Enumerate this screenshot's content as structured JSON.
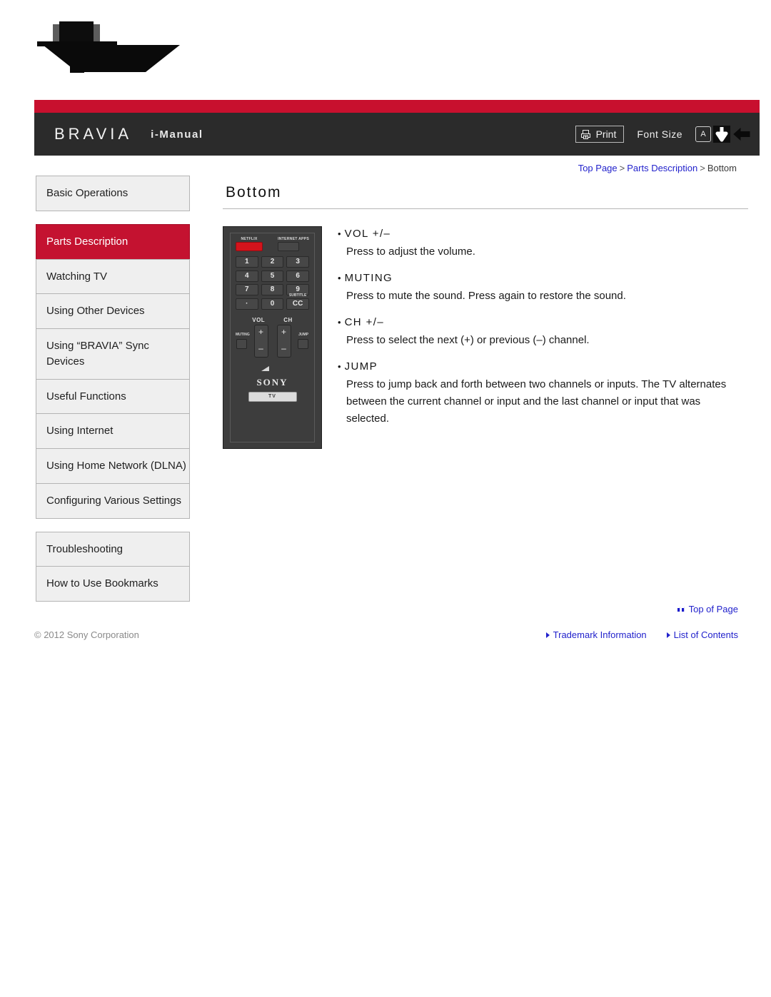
{
  "header": {
    "brand": "BRAVIA",
    "brand_sub": "i-Manual",
    "print_label": "Print",
    "font_size_label": "Font Size",
    "font_size_value": "A",
    "accent_red": "#c8102e",
    "bar_dark": "#2b2b2b"
  },
  "breadcrumb": {
    "items": [
      {
        "label": "Top Page",
        "link": true
      },
      {
        "label": "Parts Description",
        "link": true
      },
      {
        "label": "Bottom",
        "link": false
      }
    ],
    "separator": ">"
  },
  "sidebar": {
    "groups": [
      {
        "items": [
          {
            "label": "Basic Operations",
            "active": false
          }
        ]
      },
      {
        "items": [
          {
            "label": "Parts Description",
            "active": true
          },
          {
            "label": "Watching TV",
            "active": false
          },
          {
            "label": "Using Other Devices",
            "active": false
          },
          {
            "label": "Using “BRAVIA” Sync Devices",
            "active": false
          },
          {
            "label": "Useful Functions",
            "active": false
          },
          {
            "label": "Using Internet",
            "active": false
          },
          {
            "label": "Using Home Network (DLNA)",
            "active": false
          },
          {
            "label": "Configuring Various Settings",
            "active": false
          }
        ]
      },
      {
        "items": [
          {
            "label": "Troubleshooting",
            "active": false
          },
          {
            "label": "How to Use Bookmarks",
            "active": false
          }
        ]
      }
    ],
    "active_color": "#c41230"
  },
  "main": {
    "title": "Bottom",
    "remote": {
      "netflix_label": "NETFLIX",
      "internet_apps_label": "INTERNET APPS",
      "keys": [
        "1",
        "2",
        "3",
        "4",
        "5",
        "6",
        "7",
        "8",
        "9",
        "·",
        "0",
        "CC"
      ],
      "subtitle_label": "SUBTITLE",
      "vol_label": "VOL",
      "ch_label": "CH",
      "muting_label": "MUTING",
      "jump_label": "JUMP",
      "plus": "+",
      "minus": "–",
      "brand": "SONY",
      "tv_label": "TV"
    },
    "descriptions": [
      {
        "term": "VOL +/–",
        "text": "Press to adjust the volume."
      },
      {
        "term": "MUTING",
        "text": "Press to mute the sound. Press again to restore the sound."
      },
      {
        "term": "CH +/–",
        "text": "Press to select the next (+) or previous (–) channel."
      },
      {
        "term": "JUMP",
        "text": "Press to jump back and forth between two channels or inputs. The TV alternates between the current channel or input and the last channel or input that was selected."
      }
    ]
  },
  "footer": {
    "top_of_page": "Top of Page",
    "copyright": "© 2012 Sony Corporation",
    "links": [
      {
        "label": "Trademark Information"
      },
      {
        "label": "List of Contents"
      }
    ],
    "link_color": "#2222cc"
  }
}
